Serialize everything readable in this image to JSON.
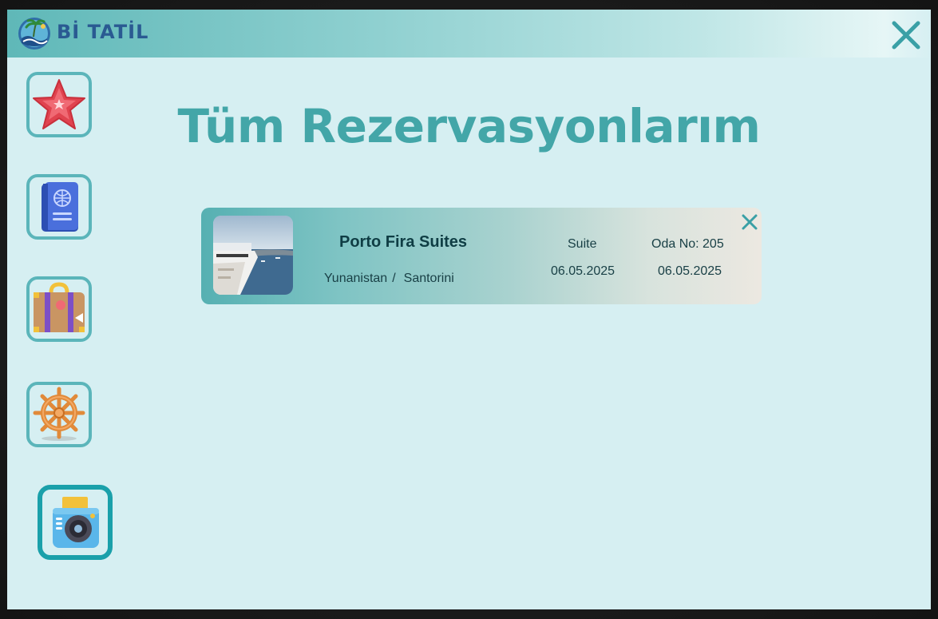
{
  "app": {
    "brand": "Bİ TATİL"
  },
  "colors": {
    "accent": "#43a6a8",
    "window_bg": "#d6eff2",
    "border": "#5bb5ba"
  },
  "sidebar": {
    "items": [
      {
        "icon": "starfish-icon"
      },
      {
        "icon": "passport-icon"
      },
      {
        "icon": "suitcase-icon"
      },
      {
        "icon": "ship-wheel-icon"
      },
      {
        "icon": "camera-icon",
        "active": true
      }
    ]
  },
  "main": {
    "title": "Tüm Rezervasyonlarım",
    "reservations": [
      {
        "hotel": "Porto Fira Suites",
        "country": "Yunanistan",
        "separator": "/",
        "city": "Santorini",
        "room_type": "Suite",
        "room_no": "Oda No: 205",
        "check_in": "06.05.2025",
        "check_out": "06.05.2025"
      }
    ]
  }
}
